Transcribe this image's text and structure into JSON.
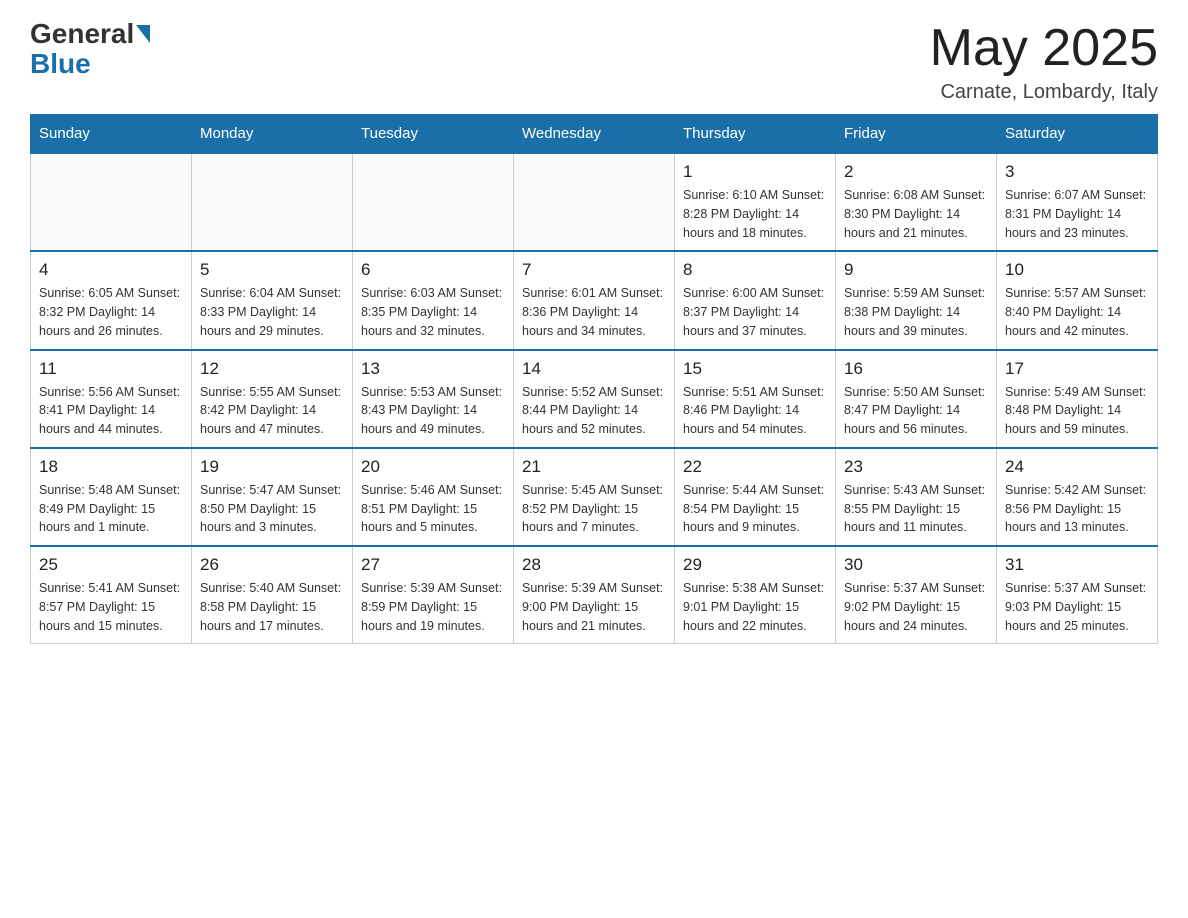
{
  "logo": {
    "general": "General",
    "blue": "Blue"
  },
  "title": "May 2025",
  "location": "Carnate, Lombardy, Italy",
  "days_of_week": [
    "Sunday",
    "Monday",
    "Tuesday",
    "Wednesday",
    "Thursday",
    "Friday",
    "Saturday"
  ],
  "weeks": [
    [
      {
        "day": "",
        "info": ""
      },
      {
        "day": "",
        "info": ""
      },
      {
        "day": "",
        "info": ""
      },
      {
        "day": "",
        "info": ""
      },
      {
        "day": "1",
        "info": "Sunrise: 6:10 AM\nSunset: 8:28 PM\nDaylight: 14 hours and 18 minutes."
      },
      {
        "day": "2",
        "info": "Sunrise: 6:08 AM\nSunset: 8:30 PM\nDaylight: 14 hours and 21 minutes."
      },
      {
        "day": "3",
        "info": "Sunrise: 6:07 AM\nSunset: 8:31 PM\nDaylight: 14 hours and 23 minutes."
      }
    ],
    [
      {
        "day": "4",
        "info": "Sunrise: 6:05 AM\nSunset: 8:32 PM\nDaylight: 14 hours and 26 minutes."
      },
      {
        "day": "5",
        "info": "Sunrise: 6:04 AM\nSunset: 8:33 PM\nDaylight: 14 hours and 29 minutes."
      },
      {
        "day": "6",
        "info": "Sunrise: 6:03 AM\nSunset: 8:35 PM\nDaylight: 14 hours and 32 minutes."
      },
      {
        "day": "7",
        "info": "Sunrise: 6:01 AM\nSunset: 8:36 PM\nDaylight: 14 hours and 34 minutes."
      },
      {
        "day": "8",
        "info": "Sunrise: 6:00 AM\nSunset: 8:37 PM\nDaylight: 14 hours and 37 minutes."
      },
      {
        "day": "9",
        "info": "Sunrise: 5:59 AM\nSunset: 8:38 PM\nDaylight: 14 hours and 39 minutes."
      },
      {
        "day": "10",
        "info": "Sunrise: 5:57 AM\nSunset: 8:40 PM\nDaylight: 14 hours and 42 minutes."
      }
    ],
    [
      {
        "day": "11",
        "info": "Sunrise: 5:56 AM\nSunset: 8:41 PM\nDaylight: 14 hours and 44 minutes."
      },
      {
        "day": "12",
        "info": "Sunrise: 5:55 AM\nSunset: 8:42 PM\nDaylight: 14 hours and 47 minutes."
      },
      {
        "day": "13",
        "info": "Sunrise: 5:53 AM\nSunset: 8:43 PM\nDaylight: 14 hours and 49 minutes."
      },
      {
        "day": "14",
        "info": "Sunrise: 5:52 AM\nSunset: 8:44 PM\nDaylight: 14 hours and 52 minutes."
      },
      {
        "day": "15",
        "info": "Sunrise: 5:51 AM\nSunset: 8:46 PM\nDaylight: 14 hours and 54 minutes."
      },
      {
        "day": "16",
        "info": "Sunrise: 5:50 AM\nSunset: 8:47 PM\nDaylight: 14 hours and 56 minutes."
      },
      {
        "day": "17",
        "info": "Sunrise: 5:49 AM\nSunset: 8:48 PM\nDaylight: 14 hours and 59 minutes."
      }
    ],
    [
      {
        "day": "18",
        "info": "Sunrise: 5:48 AM\nSunset: 8:49 PM\nDaylight: 15 hours and 1 minute."
      },
      {
        "day": "19",
        "info": "Sunrise: 5:47 AM\nSunset: 8:50 PM\nDaylight: 15 hours and 3 minutes."
      },
      {
        "day": "20",
        "info": "Sunrise: 5:46 AM\nSunset: 8:51 PM\nDaylight: 15 hours and 5 minutes."
      },
      {
        "day": "21",
        "info": "Sunrise: 5:45 AM\nSunset: 8:52 PM\nDaylight: 15 hours and 7 minutes."
      },
      {
        "day": "22",
        "info": "Sunrise: 5:44 AM\nSunset: 8:54 PM\nDaylight: 15 hours and 9 minutes."
      },
      {
        "day": "23",
        "info": "Sunrise: 5:43 AM\nSunset: 8:55 PM\nDaylight: 15 hours and 11 minutes."
      },
      {
        "day": "24",
        "info": "Sunrise: 5:42 AM\nSunset: 8:56 PM\nDaylight: 15 hours and 13 minutes."
      }
    ],
    [
      {
        "day": "25",
        "info": "Sunrise: 5:41 AM\nSunset: 8:57 PM\nDaylight: 15 hours and 15 minutes."
      },
      {
        "day": "26",
        "info": "Sunrise: 5:40 AM\nSunset: 8:58 PM\nDaylight: 15 hours and 17 minutes."
      },
      {
        "day": "27",
        "info": "Sunrise: 5:39 AM\nSunset: 8:59 PM\nDaylight: 15 hours and 19 minutes."
      },
      {
        "day": "28",
        "info": "Sunrise: 5:39 AM\nSunset: 9:00 PM\nDaylight: 15 hours and 21 minutes."
      },
      {
        "day": "29",
        "info": "Sunrise: 5:38 AM\nSunset: 9:01 PM\nDaylight: 15 hours and 22 minutes."
      },
      {
        "day": "30",
        "info": "Sunrise: 5:37 AM\nSunset: 9:02 PM\nDaylight: 15 hours and 24 minutes."
      },
      {
        "day": "31",
        "info": "Sunrise: 5:37 AM\nSunset: 9:03 PM\nDaylight: 15 hours and 25 minutes."
      }
    ]
  ]
}
